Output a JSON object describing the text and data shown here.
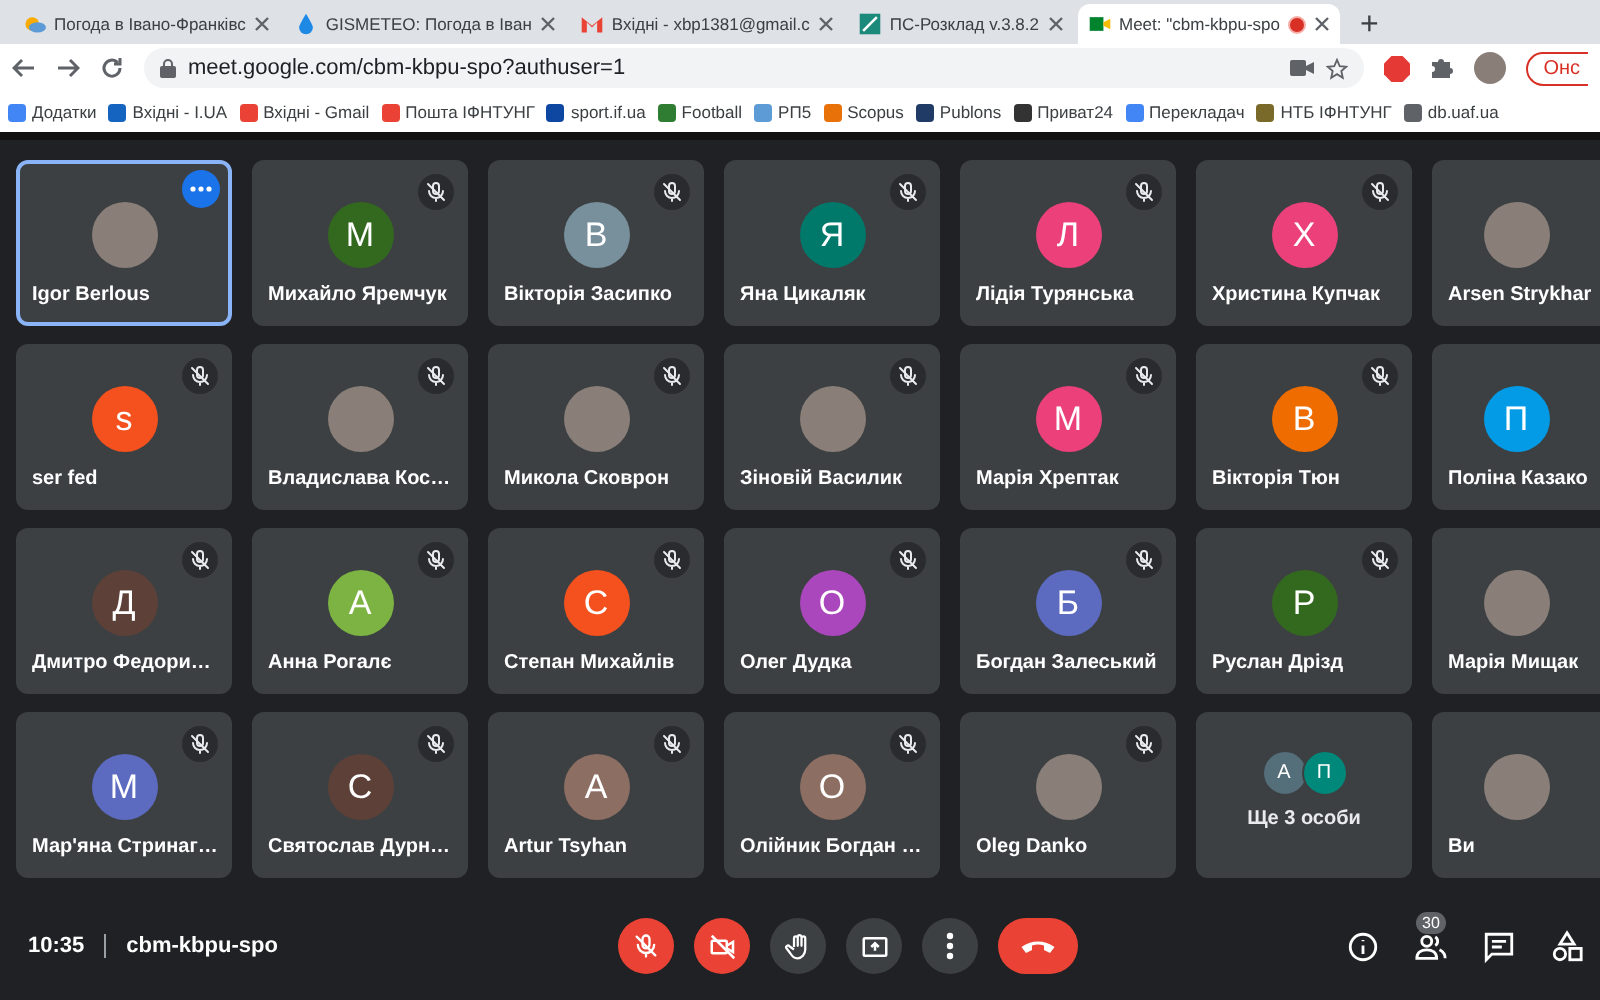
{
  "browser": {
    "tabs": [
      {
        "title": "Погода в Івано-Франківс",
        "selected": false,
        "recording": false
      },
      {
        "title": "GISMETEO: Погода в Іван",
        "selected": false,
        "recording": false
      },
      {
        "title": "Вхідні - xbp1381@gmail.c",
        "selected": false,
        "recording": false
      },
      {
        "title": "ПС-Розклад v.3.8.2",
        "selected": false,
        "recording": false
      },
      {
        "title": "Meet: \"cbm-kbpu-spo",
        "selected": true,
        "recording": true
      }
    ],
    "new_tab": "+",
    "url": "meet.google.com/cbm-kbpu-spo?authuser=1",
    "profile_button": "Онс",
    "bookmarks": [
      {
        "label": "Додатки",
        "color": "#4285f4"
      },
      {
        "label": "Вхідні - I.UA",
        "color": "#1565c0"
      },
      {
        "label": "Вхідні -  Gmail",
        "color": "#ea4335"
      },
      {
        "label": "Пошта ІФНТУНГ",
        "color": "#ea4335"
      },
      {
        "label": "sport.if.ua",
        "color": "#0d47a1"
      },
      {
        "label": "Football",
        "color": "#2e7d32"
      },
      {
        "label": "РП5",
        "color": "#5c9bd5"
      },
      {
        "label": "Scopus",
        "color": "#e8710a"
      },
      {
        "label": "Publons",
        "color": "#1f3b66"
      },
      {
        "label": "Приват24",
        "color": "#333333"
      },
      {
        "label": "Перекладач",
        "color": "#4285f4"
      },
      {
        "label": "НТБ ІФНТУНГ",
        "color": "#7a6a2a"
      },
      {
        "label": "db.uaf.ua",
        "color": "#5f6368"
      }
    ]
  },
  "meet": {
    "tiles": [
      {
        "kind": "photo",
        "name": "Igor Berlous",
        "selected": true,
        "muted": false
      },
      {
        "kind": "letter",
        "initial": "М",
        "color": "#33691e",
        "name": "Михайло Яремчук",
        "selected": false,
        "muted": true
      },
      {
        "kind": "letter",
        "initial": "В",
        "color": "#78909c",
        "name": "Вікторія Засипко",
        "selected": false,
        "muted": true
      },
      {
        "kind": "letter",
        "initial": "Я",
        "color": "#00796b",
        "name": "Яна Цикаляк",
        "selected": false,
        "muted": true
      },
      {
        "kind": "letter",
        "initial": "Л",
        "color": "#ec407a",
        "name": "Лідія Турянська",
        "selected": false,
        "muted": true
      },
      {
        "kind": "letter",
        "initial": "Х",
        "color": "#ec407a",
        "name": "Христина Купчак",
        "selected": false,
        "muted": true
      },
      {
        "kind": "photo",
        "name": "Arsen Strykhar",
        "selected": false,
        "muted": false
      },
      {
        "kind": "letter",
        "initial": "s",
        "color": "#f4511e",
        "name": "ser fed",
        "selected": false,
        "muted": true
      },
      {
        "kind": "photo",
        "name": "Владислава Кос…",
        "selected": false,
        "muted": true
      },
      {
        "kind": "photo",
        "name": "Микола Сковрон",
        "selected": false,
        "muted": true
      },
      {
        "kind": "photo",
        "name": "Зіновій Василик",
        "selected": false,
        "muted": true
      },
      {
        "kind": "letter",
        "initial": "М",
        "color": "#ec407a",
        "name": "Марія Хрептак",
        "selected": false,
        "muted": true
      },
      {
        "kind": "letter",
        "initial": "В",
        "color": "#ef6c00",
        "name": "Вікторія Тюн",
        "selected": false,
        "muted": true
      },
      {
        "kind": "letter",
        "initial": "П",
        "color": "#039be5",
        "name": "Поліна Казако",
        "selected": false,
        "muted": false
      },
      {
        "kind": "letter",
        "initial": "Д",
        "color": "#5d4037",
        "name": "Дмитро Федори…",
        "selected": false,
        "muted": true
      },
      {
        "kind": "letter",
        "initial": "А",
        "color": "#7cb342",
        "name": "Анна Рогалє",
        "selected": false,
        "muted": true
      },
      {
        "kind": "letter",
        "initial": "С",
        "color": "#f4511e",
        "name": "Степан Михайлів",
        "selected": false,
        "muted": true
      },
      {
        "kind": "letter",
        "initial": "О",
        "color": "#ab47bc",
        "name": "Олег Дудка",
        "selected": false,
        "muted": true
      },
      {
        "kind": "letter",
        "initial": "Б",
        "color": "#5c6bc0",
        "name": "Богдан Залеський",
        "selected": false,
        "muted": true
      },
      {
        "kind": "letter",
        "initial": "Р",
        "color": "#33691e",
        "name": "Руслан Дрізд",
        "selected": false,
        "muted": true
      },
      {
        "kind": "photo",
        "name": "Марія Мищак",
        "selected": false,
        "muted": false
      },
      {
        "kind": "letter",
        "initial": "М",
        "color": "#5c6bc0",
        "name": "Мар'яна Стринаг…",
        "selected": false,
        "muted": true
      },
      {
        "kind": "letter",
        "initial": "С",
        "color": "#5d4037",
        "name": "Святослав Дурн…",
        "selected": false,
        "muted": true
      },
      {
        "kind": "letter",
        "initial": "А",
        "color": "#8d6e63",
        "name": "Artur Tsyhan",
        "selected": false,
        "muted": true
      },
      {
        "kind": "letter",
        "initial": "О",
        "color": "#8d6e63",
        "name": "Олійник Богдан …",
        "selected": false,
        "muted": true
      },
      {
        "kind": "photo",
        "name": "Oleg Danko",
        "selected": false,
        "muted": true
      },
      {
        "kind": "others",
        "name": "Ще 3 особи",
        "avatars": [
          {
            "initial": "А",
            "color": "#546e7a"
          },
          {
            "initial": "П",
            "color": "#00897b"
          }
        ],
        "selected": false,
        "muted": false
      },
      {
        "kind": "photo",
        "name": "Ви",
        "selected": false,
        "muted": false
      }
    ],
    "time": "10:35",
    "meeting_code": "cbm-kbpu-spo",
    "controls": [
      {
        "kind": "mic",
        "on": false
      },
      {
        "kind": "camera",
        "on": false
      },
      {
        "kind": "hand"
      },
      {
        "kind": "present"
      },
      {
        "kind": "more"
      },
      {
        "kind": "leave"
      }
    ],
    "side_controls": [
      {
        "kind": "info"
      },
      {
        "kind": "people",
        "badge": "30"
      },
      {
        "kind": "chat"
      },
      {
        "kind": "activities"
      }
    ]
  }
}
